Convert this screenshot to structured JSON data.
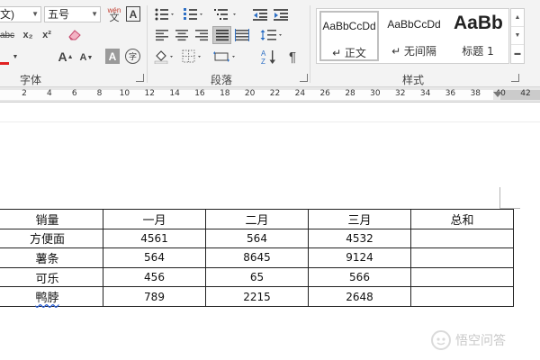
{
  "ribbon": {
    "font_group": {
      "label": "字体",
      "font_name_partial": "文)",
      "font_size": "五号",
      "phonetic_label": "wén",
      "phonetic_char": "文",
      "char_border": "A",
      "strike": "abc",
      "subscript": "x₂",
      "superscript": "x²",
      "grow_font": "A",
      "shrink_font": "A",
      "char_shading": "A",
      "enclose_char": "字",
      "font_color_icon": "font-color-icon"
    },
    "paragraph_group": {
      "label": "段落"
    },
    "styles_group": {
      "label": "样式",
      "items": [
        {
          "sample": "AaBbCcDd",
          "name": "↵ 正文",
          "selected": true
        },
        {
          "sample": "AaBbCcDd",
          "name": "↵ 无间隔",
          "selected": false
        },
        {
          "sample": "AaBb",
          "name": "标题 1",
          "selected": false
        }
      ]
    }
  },
  "ruler": {
    "ticks": [
      "2",
      "4",
      "6",
      "8",
      "10",
      "12",
      "14",
      "16",
      "18",
      "20",
      "22",
      "24",
      "26",
      "28",
      "30",
      "32",
      "34",
      "36",
      "38",
      "40",
      "42"
    ]
  },
  "table": {
    "header": [
      "销量",
      "一月",
      "二月",
      "三月",
      "总和"
    ],
    "rows": [
      [
        "方便面",
        "4561",
        "564",
        "4532",
        ""
      ],
      [
        "薯条",
        "564",
        "8645",
        "9124",
        ""
      ],
      [
        "可乐",
        "456",
        "65",
        "566",
        ""
      ],
      [
        "鸭脖",
        "789",
        "2215",
        "2648",
        ""
      ]
    ]
  },
  "watermark": {
    "text": "悟空问答"
  }
}
